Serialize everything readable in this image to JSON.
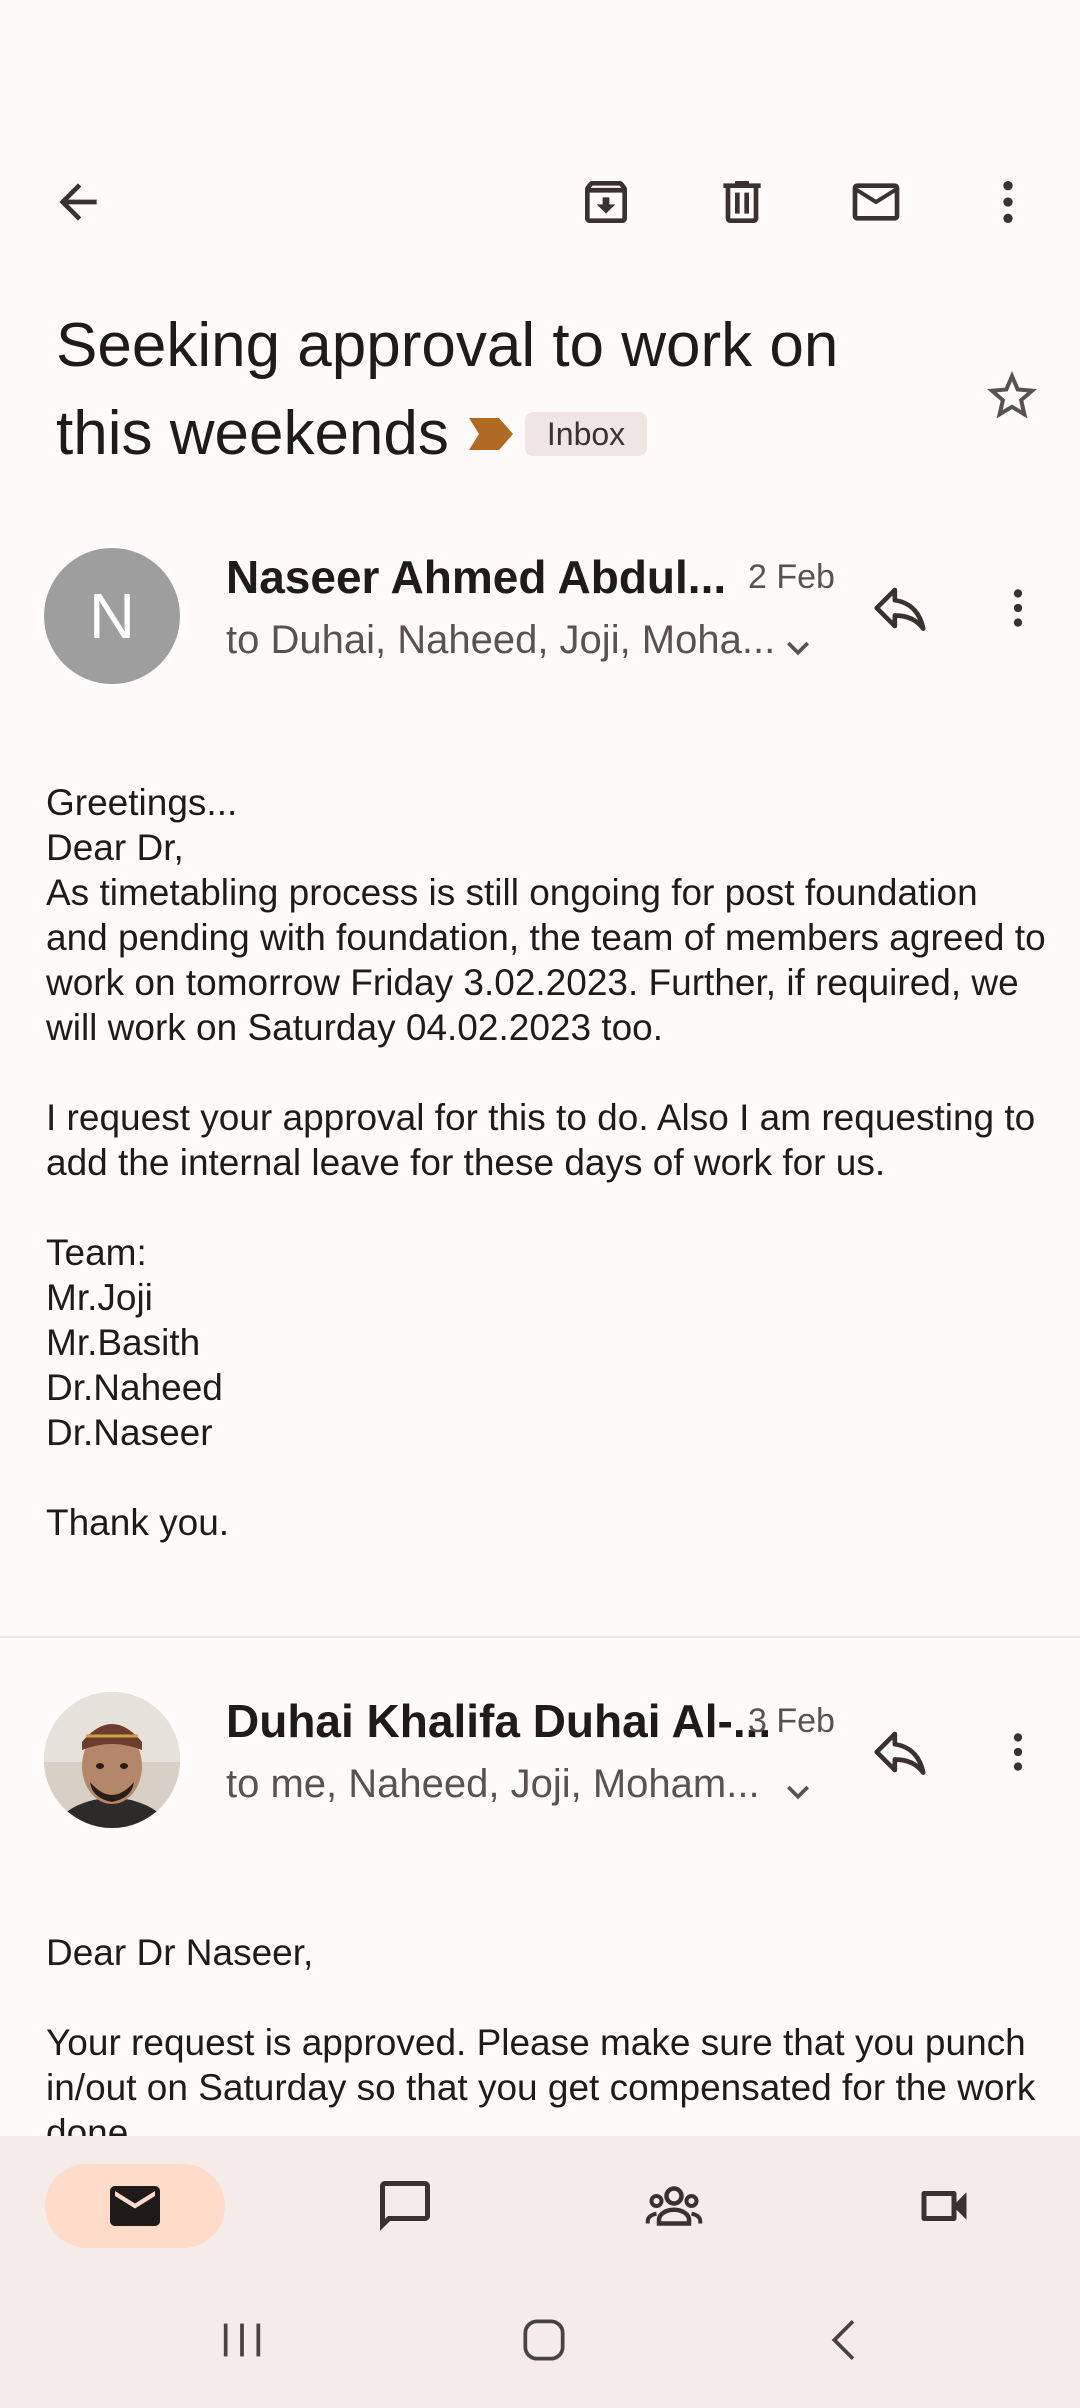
{
  "toolbar": {
    "back_icon": "arrow-back-icon",
    "archive_icon": "archive-icon",
    "delete_icon": "delete-icon",
    "mark_unread_icon": "mail-icon",
    "more_icon": "more-vert-icon"
  },
  "subject": {
    "line1": "Seeking approval to work on",
    "line2": "this weekends",
    "label": "Inbox",
    "label_color": "#b06a22",
    "star_icon": "star-outline-icon"
  },
  "messages": [
    {
      "avatar_letter": "N",
      "avatar_color": "#9e9e9e",
      "sender": "Naseer Ahmed Abdul...",
      "date": "2 Feb",
      "recipients": "to Duhai, Naheed, Joji, Moha...",
      "body": [
        "Greetings...",
        "Dear Dr,",
        "As timetabling process is still ongoing for post foundation and pending with foundation, the team of members agreed to work on tomorrow Friday 3.02.2023. Further, if required, we will work on Saturday 04.02.2023 too.",
        "",
        "I request your approval for this to do. Also I am requesting to add the internal leave for these days of work for us.",
        "",
        "Team:",
        "Mr.Joji",
        "Mr.Basith",
        "Dr.Naheed",
        "Dr.Naseer",
        "",
        "Thank you."
      ]
    },
    {
      "avatar_letter": "",
      "sender": "Duhai Khalifa Duhai Al-...",
      "date": "3 Feb",
      "recipients": "to me, Naheed, Joji, Moham...",
      "body": [
        "Dear Dr Naseer,",
        "",
        "Your request is approved. Please make sure that you punch in/out on Saturday so that you get compensated for the work done."
      ]
    }
  ],
  "bottom_nav": {
    "items": [
      {
        "icon": "mail-icon",
        "active": true
      },
      {
        "icon": "chat-icon",
        "active": false
      },
      {
        "icon": "spaces-icon",
        "active": false
      },
      {
        "icon": "meet-icon",
        "active": false
      }
    ],
    "active_color": "#ffdbc9"
  },
  "system_nav": {
    "items": [
      "recent-apps-icon",
      "home-icon",
      "back-icon"
    ]
  }
}
